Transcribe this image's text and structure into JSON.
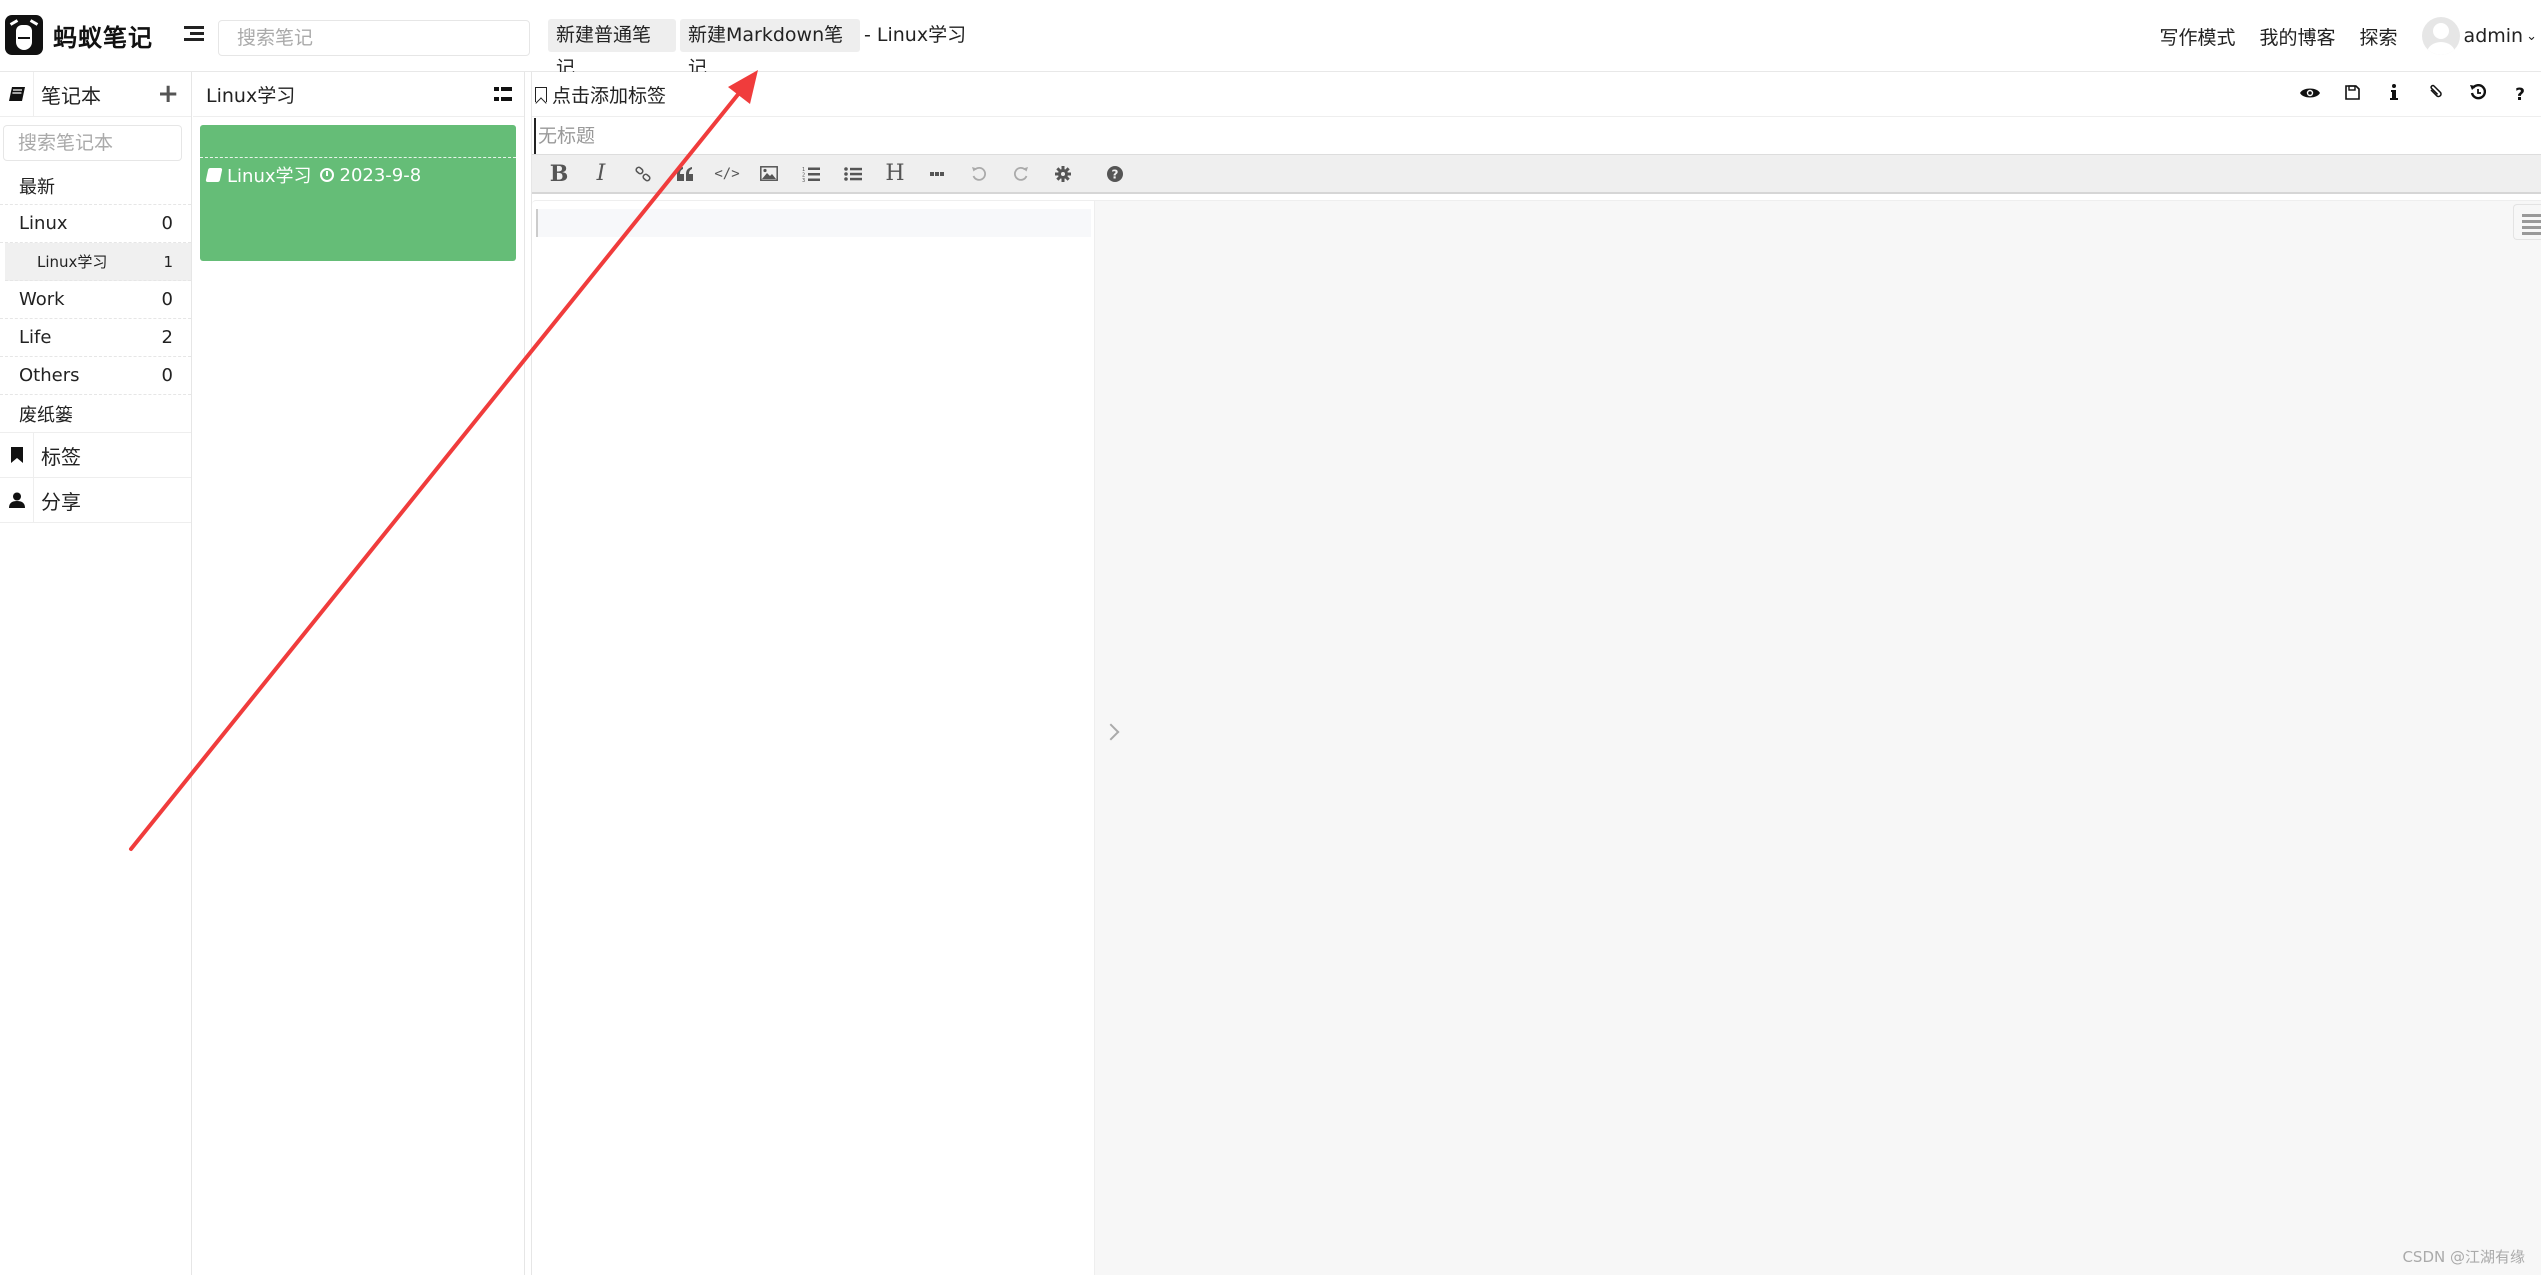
{
  "header": {
    "app_name": "蚂蚁笔记",
    "search_placeholder": "搜索笔记",
    "new_normal_note": "新建普通笔记",
    "new_markdown_note": "新建Markdown笔记",
    "current_notebook": "- Linux学习",
    "links": [
      "写作模式",
      "我的博客",
      "探索"
    ],
    "user": "admin"
  },
  "sidebar": {
    "notebooks_title": "笔记本",
    "notebook_search_placeholder": "搜索笔记本",
    "latest": "最新",
    "notebooks": [
      {
        "name": "Linux",
        "count": "0"
      },
      {
        "name": "Linux学习",
        "count": "1",
        "sub": true,
        "selected": true
      },
      {
        "name": "Work",
        "count": "0"
      },
      {
        "name": "Life",
        "count": "2"
      },
      {
        "name": "Others",
        "count": "0"
      }
    ],
    "trash": "废纸篓",
    "tags": "标签",
    "share": "分享"
  },
  "note_list": {
    "title": "Linux学习",
    "notes": [
      {
        "notebook": "Linux学习",
        "date": "2023-9-8",
        "color": "#65bd77"
      }
    ]
  },
  "editor": {
    "add_tag": "点击添加标签",
    "title_placeholder": "无标题",
    "right_tools": [
      "eye-icon",
      "save-icon",
      "info-icon",
      "attachment-icon",
      "history-icon",
      "help-icon"
    ],
    "toolbar": [
      "bold",
      "italic",
      "link",
      "quote",
      "code",
      "image",
      "ordered-list",
      "unordered-list",
      "heading",
      "horizontal-rule",
      "undo",
      "redo",
      "settings",
      "help"
    ]
  },
  "watermark": "CSDN @江湖有缘",
  "annotation": {
    "color": "#f03c3c"
  }
}
